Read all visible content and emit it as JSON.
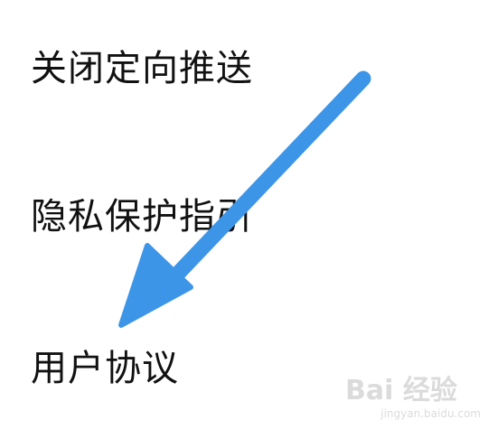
{
  "menu": {
    "items": [
      {
        "label": "关闭定向推送"
      },
      {
        "label": "隐私保护指引"
      },
      {
        "label": "用户协议"
      }
    ]
  },
  "annotation": {
    "type": "arrow",
    "color": "#3d95e8",
    "points_to": "用户协议"
  },
  "watermark": {
    "brand": "Bai 经验",
    "url": "jingyan.baidu.com"
  }
}
